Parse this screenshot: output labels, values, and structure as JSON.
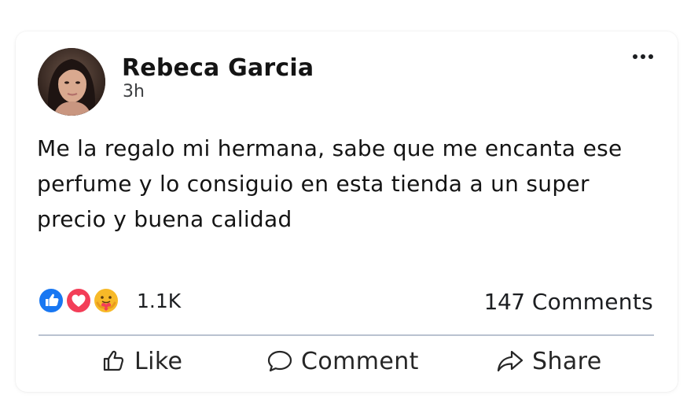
{
  "post": {
    "author": "Rebeca Garcia",
    "time": "3h",
    "text": "Me la regalo mi hermana, sabe que me encanta ese perfume y lo consiguio en esta tienda a un super precio y buena calidad",
    "reaction_icons": [
      "like-reaction-icon",
      "love-reaction-icon",
      "care-reaction-icon"
    ],
    "reaction_count": "1.1K",
    "comments_count": "147",
    "comments_label": "Comments"
  },
  "actions": {
    "like": "Like",
    "comment": "Comment",
    "share": "Share"
  },
  "colors": {
    "like_blue": "#1877f2",
    "love_red": "#f33e58",
    "care_yellow": "#f7b928",
    "divider": "#b9c2d0"
  }
}
